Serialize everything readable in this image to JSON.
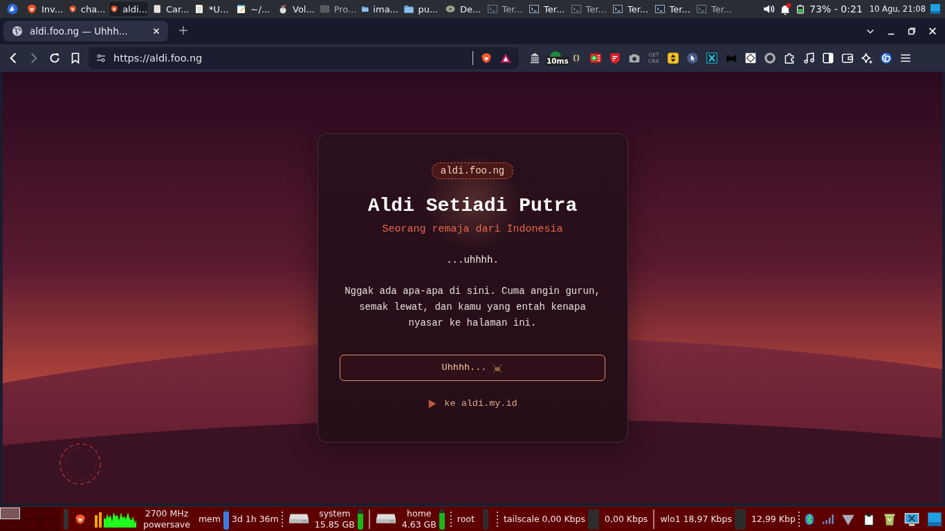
{
  "top_panel": {
    "tasks": [
      {
        "kind": "brave",
        "label": "Inv...",
        "selected": false,
        "minimized": false
      },
      {
        "kind": "brave",
        "label": "cha...",
        "selected": false,
        "minimized": false
      },
      {
        "kind": "brave",
        "label": "aldi...",
        "selected": true,
        "minimized": false
      },
      {
        "kind": "note",
        "label": "Car...",
        "selected": false,
        "minimized": false
      },
      {
        "kind": "note",
        "label": "*U...",
        "selected": false,
        "minimized": false
      },
      {
        "kind": "notepad",
        "label": "~/...",
        "selected": false,
        "minimized": false
      },
      {
        "kind": "speaker",
        "label": "Vol...",
        "selected": false,
        "minimized": false
      },
      {
        "kind": "window",
        "label": "Pro...",
        "selected": false,
        "minimized": true
      },
      {
        "kind": "folder",
        "label": "ima...",
        "selected": false,
        "minimized": false
      },
      {
        "kind": "folder",
        "label": "pu...",
        "selected": false,
        "minimized": false
      },
      {
        "kind": "disc",
        "label": "De...",
        "selected": false,
        "minimized": false
      },
      {
        "kind": "terminal",
        "label": "Ter...",
        "selected": false,
        "minimized": true
      },
      {
        "kind": "terminal",
        "label": "Ter...",
        "selected": false,
        "minimized": false
      },
      {
        "kind": "terminal",
        "label": "Ter...",
        "selected": false,
        "minimized": true
      },
      {
        "kind": "terminal",
        "label": "Ter...",
        "selected": false,
        "minimized": false
      },
      {
        "kind": "terminal",
        "label": "Ter...",
        "selected": false,
        "minimized": false
      },
      {
        "kind": "terminal",
        "label": "Ter...",
        "selected": false,
        "minimized": true
      }
    ],
    "battery": "73% - 0:21",
    "clock": "10 Agu, 21:08"
  },
  "browser": {
    "tab_title": "aldi.foo.ng — Uhhh...",
    "url": "https://aldi.foo.ng",
    "extensions": [
      {
        "kind": "archive"
      },
      {
        "kind": "ping",
        "label": "10ms"
      },
      {
        "kind": "braces"
      },
      {
        "kind": "player"
      },
      {
        "kind": "shield"
      },
      {
        "kind": "camera"
      },
      {
        "kind": "crx",
        "label": "GET CRX"
      },
      {
        "kind": "updown"
      },
      {
        "kind": "cursor"
      },
      {
        "kind": "xbox"
      },
      {
        "kind": "cat"
      },
      {
        "kind": "sign"
      },
      {
        "kind": "ring"
      },
      {
        "kind": "puzzle"
      },
      {
        "kind": "music"
      },
      {
        "kind": "sidebar"
      },
      {
        "kind": "wallet"
      },
      {
        "kind": "sparkle"
      },
      {
        "kind": "swirl"
      },
      {
        "kind": "menu"
      }
    ]
  },
  "page": {
    "badge": "aldi.foo.ng",
    "title": "Aldi Setiadi Putra",
    "subtitle": "Seorang remaja dari Indonesia",
    "intro": "...uhhhh.",
    "message": "Nggak ada apa-apa di sini. Cuma angin gurun, semak lewat, dan kamu yang entah kenapa nyasar ke halaman ini.",
    "button": "Uhhhh...",
    "link": "ke aldi.my.id"
  },
  "bottom_panel": {
    "desktops": [
      {
        "selected": true
      },
      {
        "selected": false
      },
      {
        "selected": false
      },
      {
        "selected": false
      },
      {
        "selected": false
      },
      {
        "selected": false
      }
    ],
    "cpu": {
      "frequency": "2700 MHz",
      "governor": "powersave"
    },
    "memory": {
      "label": "mem",
      "level": 0.85
    },
    "uptime": "3d 1h 36m",
    "drives": [
      {
        "name": "system",
        "size": "15.85 GB",
        "level": 0.75
      },
      {
        "name": "home",
        "size": "4.63 GB",
        "level": 0.8
      }
    ],
    "root_label": "root",
    "network": [
      {
        "label": "tailscale 0,00 Kbps"
      },
      {
        "label": "0,00 Kbps"
      },
      {
        "label": "wlo1 18,97 Kbps"
      },
      {
        "label": "12,99 Kbp"
      }
    ]
  }
}
